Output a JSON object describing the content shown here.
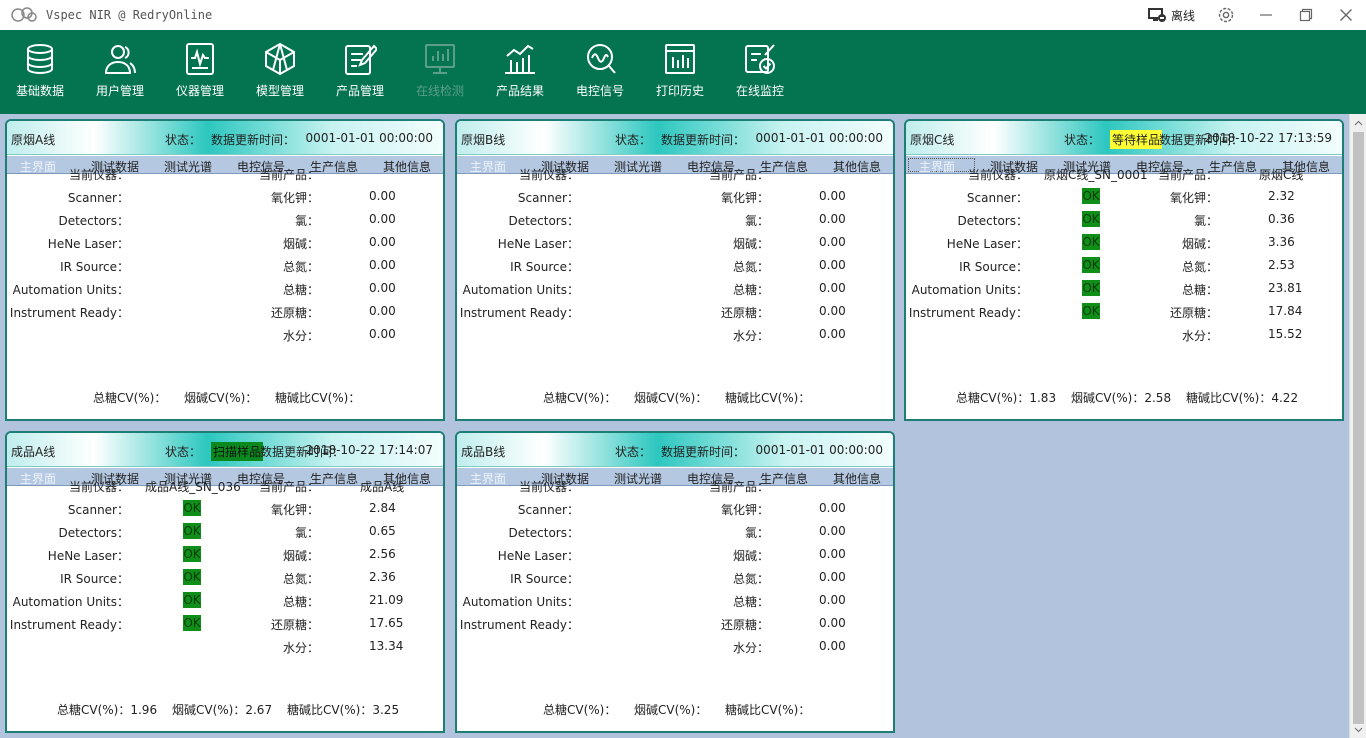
{
  "window": {
    "title": "Vspec NIR @ RedryOnline",
    "connection_status": "离线"
  },
  "toolbar": {
    "items": [
      {
        "label": "基础数据",
        "icon": "database-icon",
        "enabled": true
      },
      {
        "label": "用户管理",
        "icon": "users-icon",
        "enabled": true
      },
      {
        "label": "仪器管理",
        "icon": "instrument-icon",
        "enabled": true
      },
      {
        "label": "模型管理",
        "icon": "model-icon",
        "enabled": true
      },
      {
        "label": "产品管理",
        "icon": "product-icon",
        "enabled": true
      },
      {
        "label": "在线检测",
        "icon": "online-detect-icon",
        "enabled": false
      },
      {
        "label": "产品结果",
        "icon": "result-chart-icon",
        "enabled": true
      },
      {
        "label": "电控信号",
        "icon": "signal-icon",
        "enabled": true
      },
      {
        "label": "打印历史",
        "icon": "print-history-icon",
        "enabled": true
      },
      {
        "label": "在线监控",
        "icon": "monitor-icon",
        "enabled": true
      }
    ]
  },
  "labels": {
    "status": "状态：",
    "update_time": "数据更新时间：",
    "current_instrument": "当前仪器：",
    "current_product": "当前产品：",
    "tabs": [
      "主界面",
      "测试数据",
      "测试光谱",
      "电控信号",
      "生产信息",
      "其他信息"
    ],
    "instrument_rows": [
      "Scanner：",
      "Detectors：",
      "HeNe Laser：",
      "IR Source：",
      "Automation Units：",
      "Instrument Ready："
    ],
    "product_rows": [
      "氧化钾：",
      "氯：",
      "烟碱：",
      "总氮：",
      "总糖：",
      "还原糖：",
      "水分："
    ],
    "cv": [
      "总糖CV(%)：",
      "烟碱CV(%)：",
      "糖碱比CV(%)："
    ]
  },
  "panels": [
    {
      "name": "原烟A线",
      "status": "",
      "status_kind": "none",
      "time": "0001-01-01 00:00:00",
      "instrument": "",
      "product": "",
      "checks": [
        "",
        "",
        "",
        "",
        "",
        ""
      ],
      "values": [
        "0.00",
        "0.00",
        "0.00",
        "0.00",
        "0.00",
        "0.00",
        "0.00"
      ],
      "cv": [
        "",
        "",
        ""
      ]
    },
    {
      "name": "原烟B线",
      "status": "",
      "status_kind": "none",
      "time": "0001-01-01 00:00:00",
      "instrument": "",
      "product": "",
      "checks": [
        "",
        "",
        "",
        "",
        "",
        ""
      ],
      "values": [
        "0.00",
        "0.00",
        "0.00",
        "0.00",
        "0.00",
        "0.00",
        "0.00"
      ],
      "cv": [
        "",
        "",
        ""
      ]
    },
    {
      "name": "原烟C线",
      "status": "等待样品",
      "status_kind": "waiting",
      "time": "2018-10-22 17:13:59",
      "instrument": "原烟C线_SN_0001",
      "product": "原烟C线",
      "checks": [
        "OK",
        "OK",
        "OK",
        "OK",
        "OK",
        "OK"
      ],
      "values": [
        "2.32",
        "0.36",
        "3.36",
        "2.53",
        "23.81",
        "17.84",
        "15.52"
      ],
      "cv": [
        "1.83",
        "2.58",
        "4.22"
      ]
    },
    {
      "name": "成品A线",
      "status": "扫描样品",
      "status_kind": "scanning",
      "time": "2018-10-22 17:14:07",
      "instrument": "成品A线_SN_036",
      "product": "成品A线",
      "checks": [
        "OK",
        "OK",
        "OK",
        "OK",
        "OK",
        "OK"
      ],
      "values": [
        "2.84",
        "0.65",
        "2.56",
        "2.36",
        "21.09",
        "17.65",
        "13.34"
      ],
      "cv": [
        "1.96",
        "2.67",
        "3.25"
      ]
    },
    {
      "name": "成品B线",
      "status": "",
      "status_kind": "none",
      "time": "0001-01-01 00:00:00",
      "instrument": "",
      "product": "",
      "checks": [
        "",
        "",
        "",
        "",
        "",
        ""
      ],
      "values": [
        "0.00",
        "0.00",
        "0.00",
        "0.00",
        "0.00",
        "0.00",
        "0.00"
      ],
      "cv": [
        "",
        "",
        ""
      ]
    }
  ],
  "colors": {
    "toolbar_bg": "#047350",
    "content_bg": "#b2c3dd",
    "panel_border": "#1d7e76",
    "ok_green": "#0f8f18",
    "waiting_yellow": "#ffff33"
  }
}
